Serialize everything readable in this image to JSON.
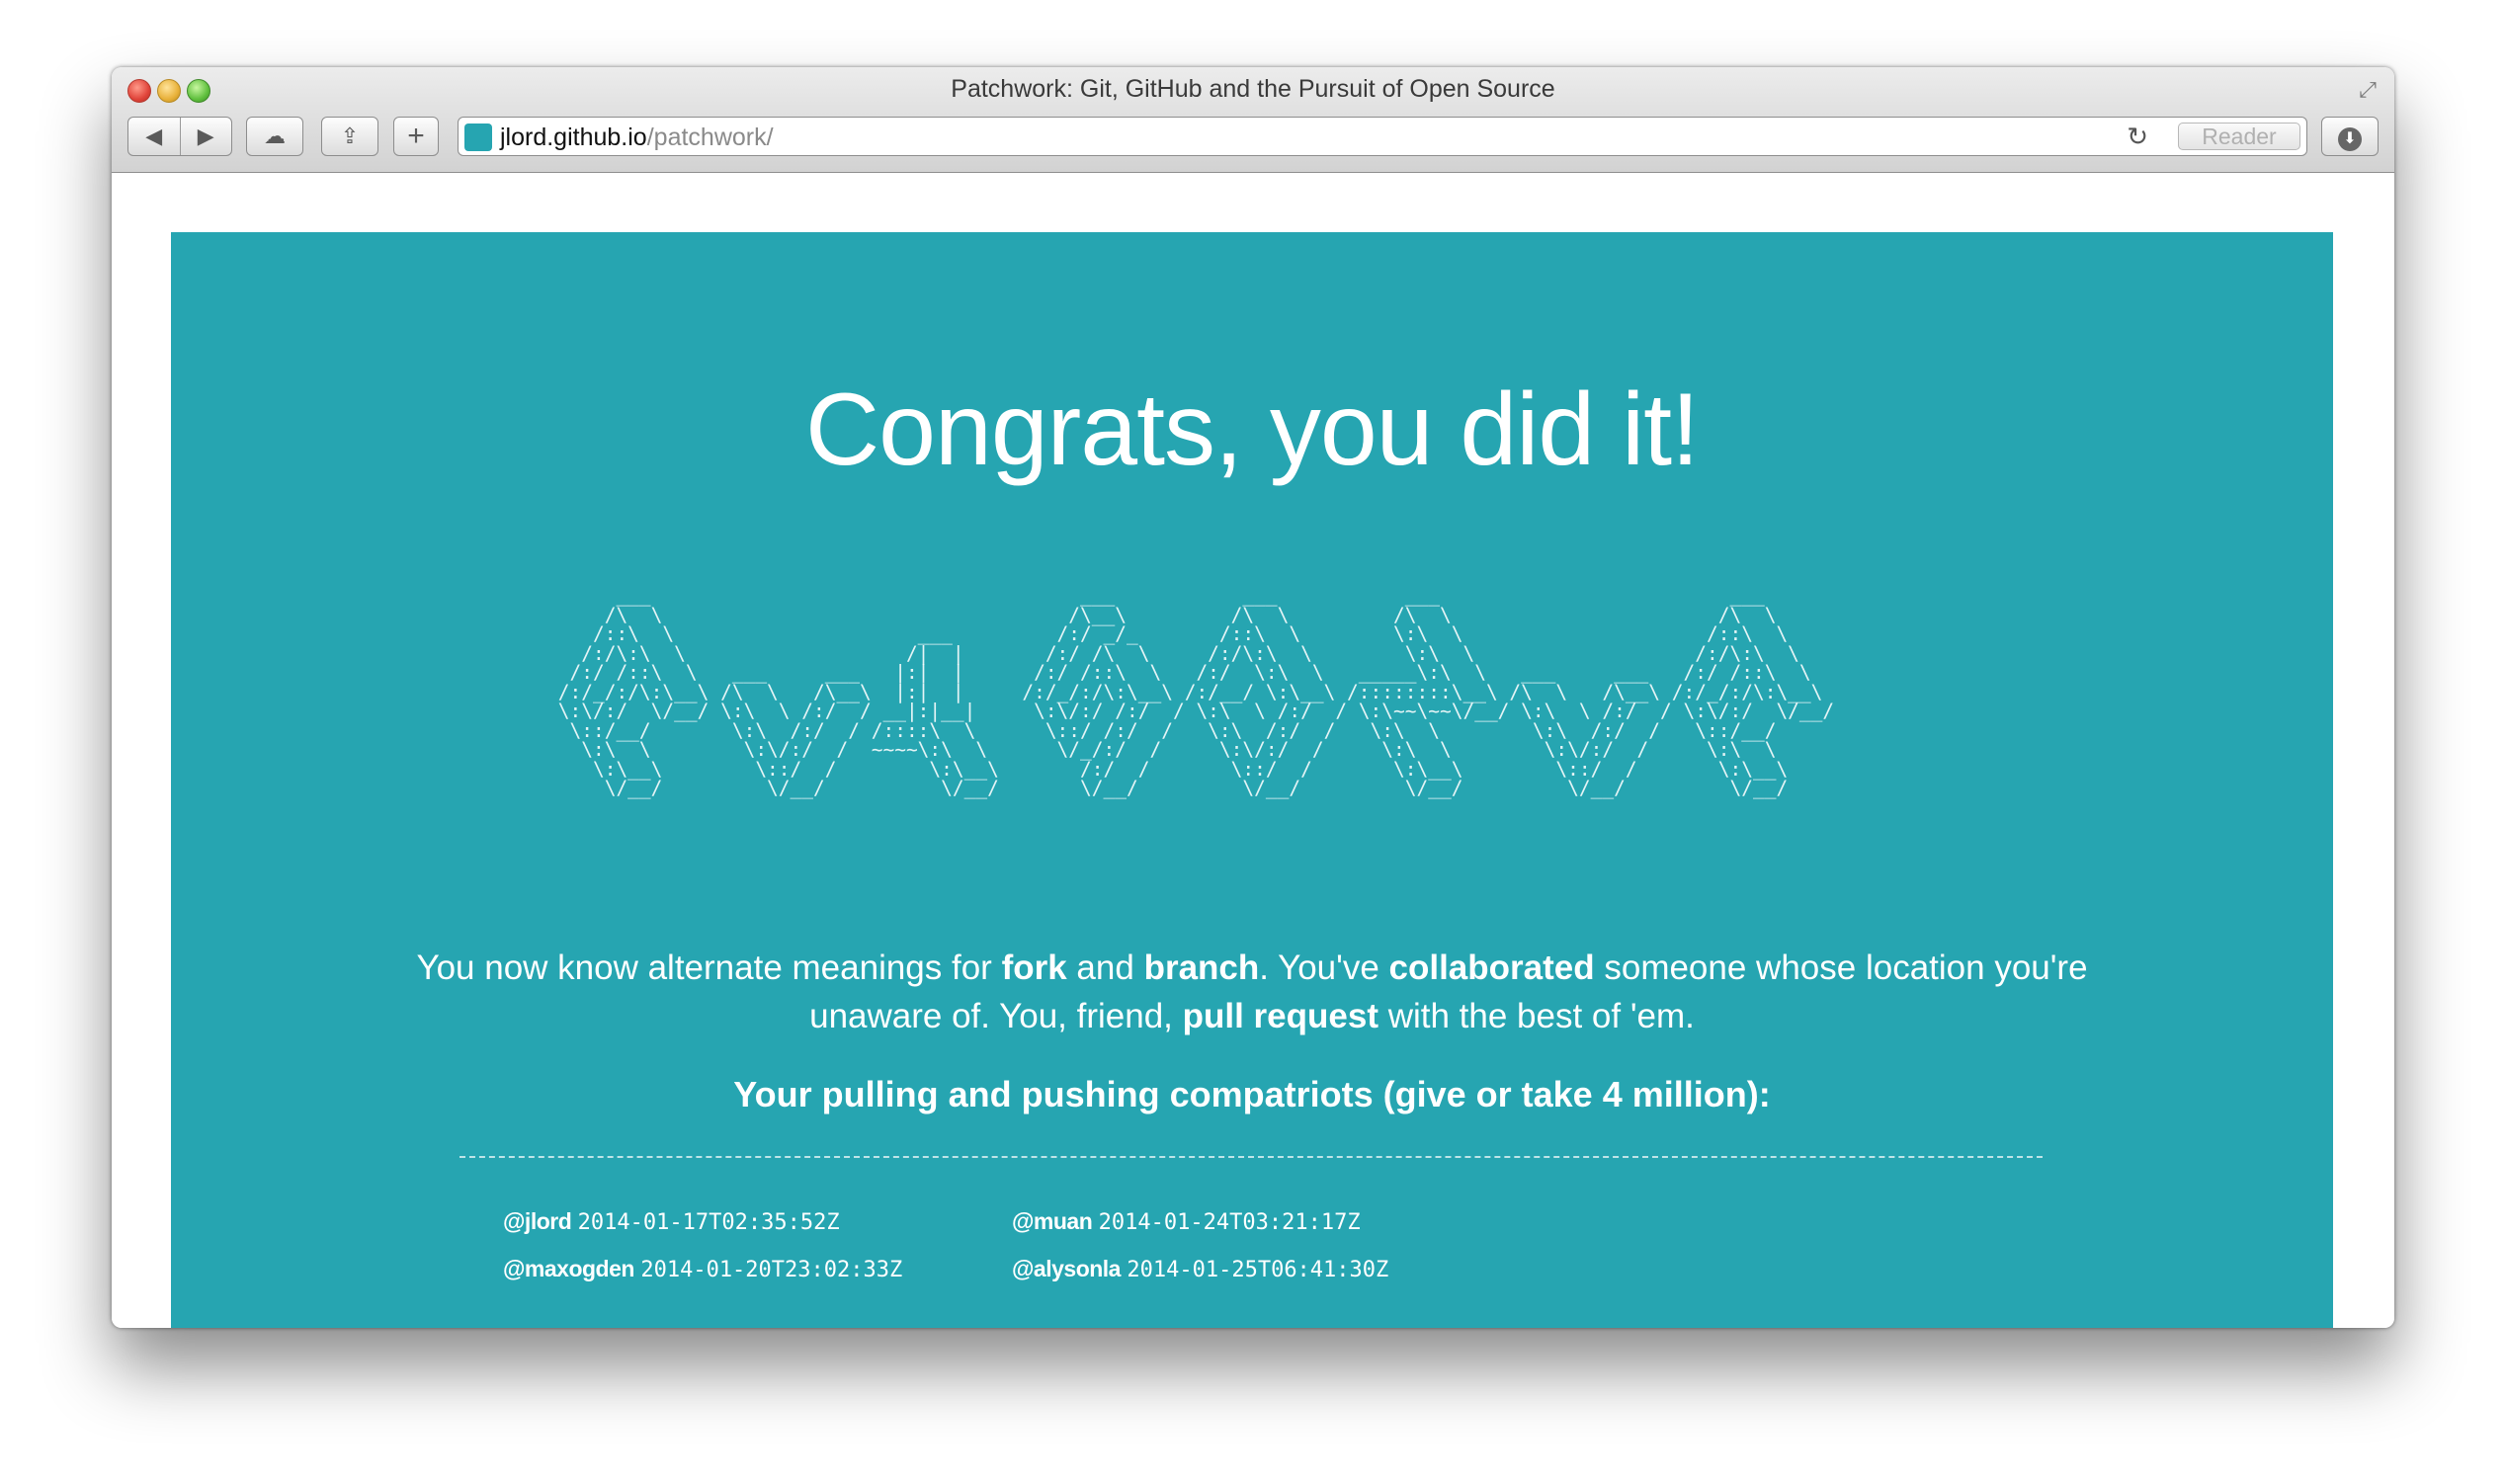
{
  "window": {
    "title": "Patchwork: Git, GitHub and the Pursuit of Open Source"
  },
  "toolbar": {
    "back_icon": "◀",
    "forward_icon": "▶",
    "cloud_icon": "☁",
    "share_icon": "⇪",
    "add_icon": "+",
    "address": {
      "host": "jlord.github.io",
      "path": "/patchwork/"
    },
    "reload_icon": "↻",
    "reader_label": "Reader",
    "download_icon": "⬇",
    "fullscreen_icon": "⤢"
  },
  "page": {
    "headline": "Congrats, you did it!",
    "ascii_art": "      ___                                     ___           ___           ___                         ___     \n     /\\  \\                                   /\\__\\         /\\  \\         /\\  \\                       /\\  \\    \n    /::\\  \\                     ___         /:/ _/_       /::\\  \\        \\:\\  \\                     /::\\  \\   \n   /:/\\:\\  \\                   /|  |       /:/ /\\  \\     /:/\\:\\  \\        \\:\\  \\                   /:/\\:\\  \\  \n  /:/ /::\\  \\   ___     ___   |:|  |      /:/ /::\\  \\   /:/  \\:\\  \\   _____\\:\\  \\   ___     ___   /:/ /::\\  \\ \n /:/_/:/\\:\\__\\ /\\  \\   /\\__\\  |:|  |     /:/_/:/\\:\\__\\ /:/__/ \\:\\__\\ /::::::::\\__\\ /\\  \\   /\\__\\ /:/_/:/\\:\\__\\\n \\:\\/:/  \\/__/ \\:\\  \\ /:/  / __|:|__|     \\:\\/:/ /:/  / \\:\\  \\ /:/  / \\:\\~~\\~~\\/__/ \\:\\  \\ /:/  / \\:\\/:/  \\/__/\n  \\::/__/       \\:\\  /:/  / /::::\\  \\      \\::/ /:/  /   \\:\\  /:/  /   \\:\\  \\        \\:\\  /:/  /   \\::/__/     \n   \\:\\  \\        \\:\\/:/  /  ~~~~\\:\\  \\      \\/_/:/  /     \\:\\/:/  /     \\:\\  \\        \\:\\/:/  /     \\:\\  \\     \n    \\:\\__\\        \\::/  /        \\:\\__\\       /:/  /       \\::/  /       \\:\\__\\        \\::/  /       \\:\\__\\    \n     \\/__/         \\/__/          \\/__/       \\/__/         \\/__/         \\/__/         \\/__/         \\/__/    ",
    "intro": {
      "p1": "You now know alternate meanings for ",
      "fork": "fork",
      "p2": " and ",
      "branch": "branch",
      "p3": ". You've ",
      "collaborated": "collaborated",
      "p4": " someone whose location you're unaware of. You, friend, ",
      "pull_request": "pull request",
      "p5": " with the best of 'em."
    },
    "compatriots_heading": "Your pulling and pushing compatriots (give or take 4 million):",
    "contributors": [
      {
        "handle": "@jlord",
        "timestamp": "2014-01-17T02:35:52Z"
      },
      {
        "handle": "@muan",
        "timestamp": "2014-01-24T03:21:17Z"
      },
      {
        "handle": "@maxogden",
        "timestamp": "2014-01-20T23:02:33Z"
      },
      {
        "handle": "@alysonla",
        "timestamp": "2014-01-25T06:41:30Z"
      }
    ]
  },
  "colors": {
    "panel_background": "#26a5b1",
    "favicon": "#26a5b1",
    "text": "#ffffff"
  }
}
